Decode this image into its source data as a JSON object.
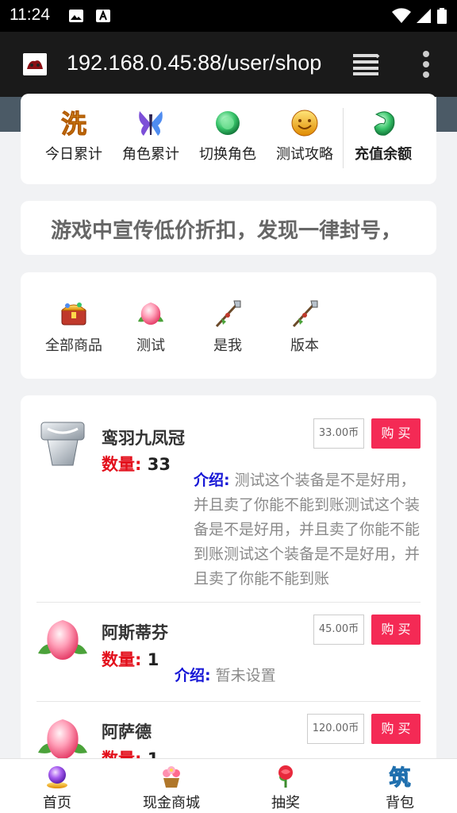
{
  "status_bar": {
    "time": "11:24"
  },
  "browser": {
    "url": "192.168.0.45:88/user/shop"
  },
  "nav": {
    "items": [
      {
        "label": "今日累计",
        "icon": "wash-icon"
      },
      {
        "label": "角色累计",
        "icon": "butterfly-icon"
      },
      {
        "label": "切换角色",
        "icon": "jade-orb-icon"
      },
      {
        "label": "测试攻略",
        "icon": "smile-coin-icon"
      },
      {
        "label": "充值余额",
        "icon": "jade-pendant-icon",
        "active": true
      }
    ]
  },
  "notice": {
    "text": "游戏中宣传低价折扣，发现一律封号，"
  },
  "categories": [
    {
      "label": "全部商品",
      "icon": "treasure-chest-icon"
    },
    {
      "label": "测试",
      "icon": "peach-icon"
    },
    {
      "label": "是我",
      "icon": "spear-icon"
    },
    {
      "label": "版本",
      "icon": "spear-icon"
    }
  ],
  "labels": {
    "quantity": "数量:",
    "desc": "介绍:",
    "buy": "购买"
  },
  "products": [
    {
      "name": "鸾羽九凤冠",
      "quantity": "33",
      "price": "33.00币",
      "description": "测试这个装备是不是好用，并且卖了你能不能到账测试这个装备是不是好用，并且卖了你能不能到账测试这个装备是不是好用，并且卖了你能不能到账",
      "icon": "crown-icon"
    },
    {
      "name": "阿斯蒂芬",
      "quantity": "1",
      "price": "45.00币",
      "description": "暂未设置",
      "icon": "peach-icon"
    },
    {
      "name": "阿萨德",
      "quantity": "1",
      "price": "120.00币",
      "description": "",
      "icon": "peach-icon"
    }
  ],
  "bottom_nav": [
    {
      "label": "首页",
      "icon": "crystal-ball-icon"
    },
    {
      "label": "现金商城",
      "icon": "flower-basket-icon"
    },
    {
      "label": "抽奖",
      "icon": "rose-icon"
    },
    {
      "label": "背包",
      "icon": "bamboo-glyph-icon"
    }
  ],
  "colors": {
    "buy": "#f42a55",
    "quantity_label": "#e3101c",
    "desc_label": "#1616d6"
  }
}
